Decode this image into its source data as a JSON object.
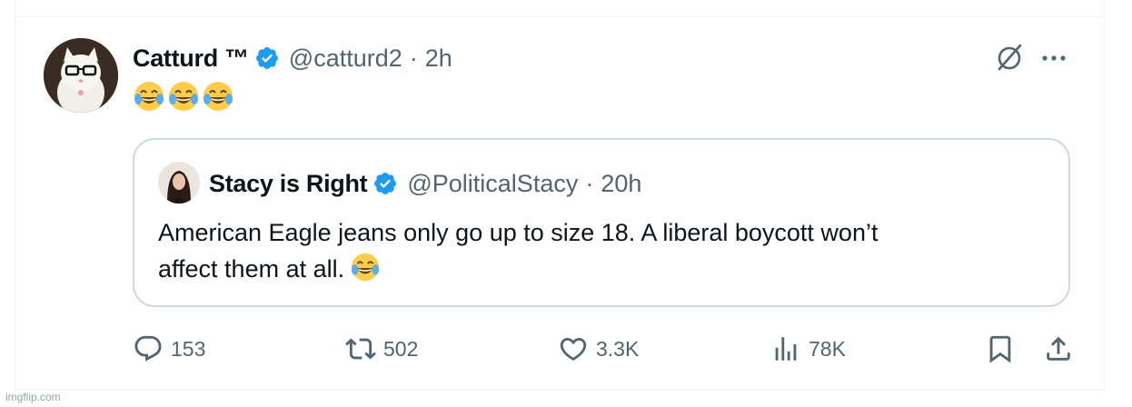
{
  "tweet": {
    "author_name": "Catturd ™",
    "author_handle": "@catturd2",
    "separator": "·",
    "time": "2h",
    "emoji_text": "😂😂😂"
  },
  "quote": {
    "author_name": "Stacy is Right",
    "author_handle": "@PoliticalStacy",
    "separator": "·",
    "time": "20h",
    "text_line1": "American Eagle jeans only go up to size 18. A liberal boycott won’t",
    "text_line2": "affect them at all."
  },
  "actions": {
    "replies": "153",
    "reposts": "502",
    "likes": "3.3K",
    "views": "78K"
  },
  "icons": {
    "verified": "verified-badge-icon",
    "grok": "grok-icon",
    "more": "more-icon",
    "reply": "reply-icon",
    "repost": "repost-icon",
    "like": "heart-icon",
    "views": "views-icon",
    "bookmark": "bookmark-icon",
    "share": "share-icon"
  },
  "colors": {
    "verified_blue": "#1d9bf0",
    "text_primary": "#0f1419",
    "text_secondary": "#536471",
    "border": "#cfd9de"
  },
  "watermark": "imgflip.com"
}
